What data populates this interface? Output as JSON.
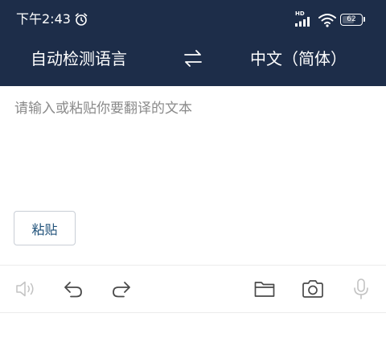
{
  "status_bar": {
    "time": "下午2:43",
    "network_label": "HD",
    "battery_percent": "62"
  },
  "header": {
    "source_language": "自动检测语言",
    "target_language": "中文（简体）"
  },
  "input": {
    "placeholder": "请输入或粘贴你要翻译的文本",
    "value": ""
  },
  "paste_button": {
    "label": "粘贴"
  },
  "toolbar": {
    "icons": [
      "speaker-icon",
      "undo-icon",
      "redo-icon",
      "folder-icon",
      "camera-icon",
      "microphone-icon"
    ]
  },
  "colors": {
    "header_background": "#1d2d49",
    "paste_text": "#1d4f78"
  }
}
